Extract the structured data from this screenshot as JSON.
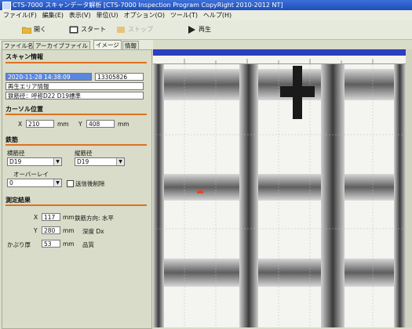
{
  "window": {
    "title": "CTS-7000 スキャンデータ解析 [CTS-7000 Inspection Program CopyRight 2010-2012 NT]"
  },
  "menu": [
    "ファイル(F)",
    "編集(E)",
    "表示(V)",
    "単位(U)",
    "オプション(O)",
    "ツール(T)",
    "ヘルプ(H)"
  ],
  "toolbar": {
    "open": "開く",
    "start": "スタート",
    "stop": "ストップ",
    "play": "再生"
  },
  "tabs": [
    "ファイル名",
    "アーカイブファイル",
    "イメージ",
    "情報"
  ],
  "scan_info": {
    "header": "スキャン情報",
    "datetime": "2020-11-28 14:38:09",
    "id": "13305826",
    "line2": "再生エリア情報",
    "line3": "鉄筋径：呼称D22 D19標準"
  },
  "cursor": {
    "header": "カーソル位置",
    "x_label": "X",
    "x_value": "210",
    "y_label": "Y",
    "y_value": "408",
    "unit": "mm"
  },
  "rebar": {
    "header": "鉄筋",
    "v_label": "横筋径",
    "v_value": "D19",
    "h_label": "縦筋径",
    "h_value": "D19",
    "overlay_label": "オーバーレイ",
    "overlay_value": "0",
    "checkbox_label": "送信後削除"
  },
  "results": {
    "header": "測定結果",
    "x_label": "X",
    "x_value": "117",
    "x_unit": "mm",
    "x_note": "鉄筋方向: 水平",
    "y_label": "Y",
    "y_value": "280",
    "y_unit": "mm",
    "y_note": "深度 Dx",
    "cover_label": "かぶり厚",
    "cover_value": "53",
    "cover_unit": "mm",
    "cover_note": "品質"
  },
  "colors": {
    "accent": "#e07020",
    "selection": "#5a86e0",
    "titlebar": "#2b52c8",
    "image_header": "#2b3fbf"
  }
}
